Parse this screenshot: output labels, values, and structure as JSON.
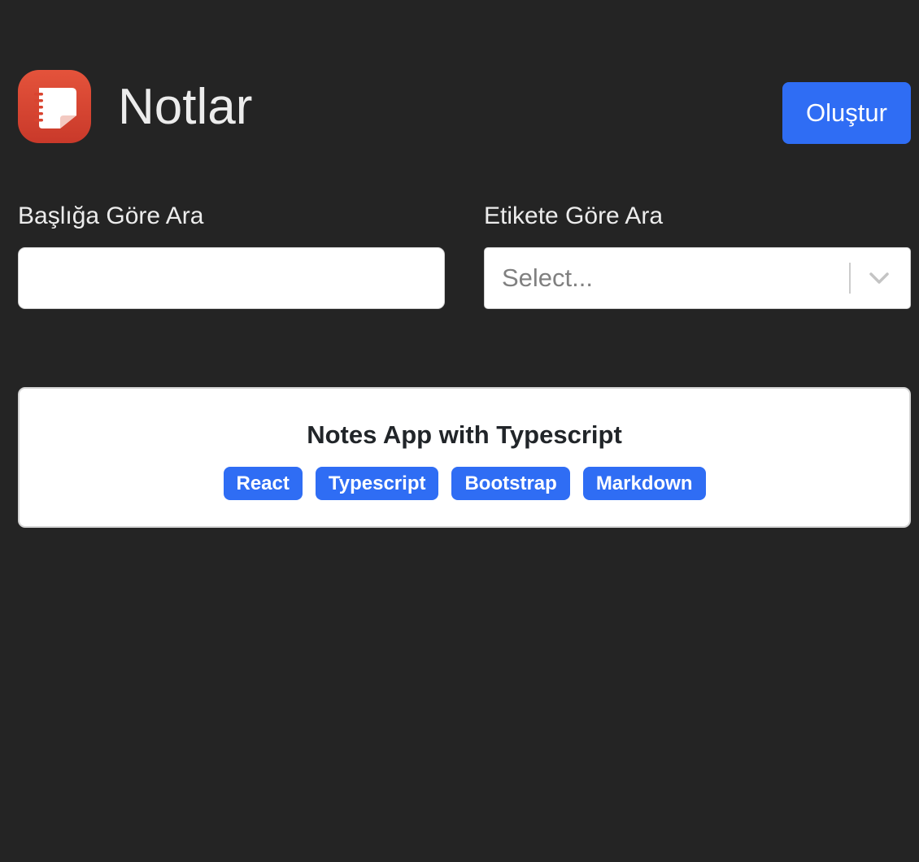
{
  "header": {
    "title": "Notlar",
    "create_label": "Oluştur"
  },
  "filters": {
    "title_label": "Başlığa Göre Ara",
    "title_value": "",
    "tag_label": "Etikete Göre Ara",
    "tag_placeholder": "Select..."
  },
  "notes": [
    {
      "title": "Notes App with Typescript",
      "tags": [
        "React",
        "Typescript",
        "Bootstrap",
        "Markdown"
      ]
    }
  ],
  "colors": {
    "background": "#242424",
    "accent": "#2f6df4",
    "logo": "#d9432f",
    "card": "#ffffff"
  },
  "icons": {
    "logo": "notes-app-icon",
    "dropdown": "chevron-down-icon"
  }
}
